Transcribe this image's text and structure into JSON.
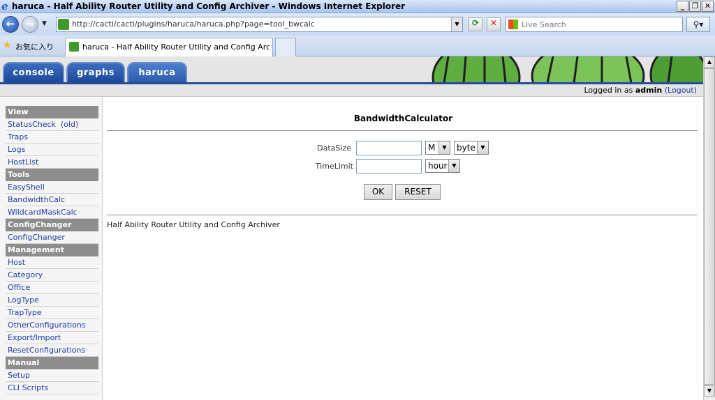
{
  "window": {
    "title": "haruca - Half Ability Router Utility and Config Archiver - Windows Internet Explorer",
    "minimize_glyph": "_",
    "maximize_glyph": "❐",
    "close_glyph": "✕"
  },
  "browser": {
    "address": "http://cacti/cacti/plugins/haruca/haruca.php?page=tool_bwcalc",
    "search_placeholder": "Live Search",
    "favorites_label": "お気に入り",
    "tab_title": "haruca - Half Ability Router Utility and Config Arc..."
  },
  "cacti": {
    "tabs": [
      {
        "label": "console"
      },
      {
        "label": "graphs"
      },
      {
        "label": "haruca"
      }
    ],
    "login_prefix": "Logged in as",
    "username": "admin",
    "logout_label": "(Logout)"
  },
  "sidebar": {
    "sections": [
      {
        "title": "View",
        "items": [
          "StatusCheck  (old)",
          "Traps",
          "Logs",
          "HostList"
        ]
      },
      {
        "title": "Tools",
        "items": [
          "EasyShell",
          "BandwidthCalc",
          "WildcardMaskCalc"
        ]
      },
      {
        "title": "ConfigChanger",
        "items": [
          "ConfigChanger"
        ]
      },
      {
        "title": "Management",
        "items": [
          "Host",
          "Category",
          "Office",
          "LogType",
          "TrapType",
          "OtherConfigurations",
          "Export/Import",
          "ResetConfigurations"
        ]
      },
      {
        "title": "Manual",
        "items": [
          "Setup",
          "CLI Scripts"
        ]
      }
    ]
  },
  "calculator": {
    "title": "BandwidthCalculator",
    "datasize_label": "DataSize",
    "datasize_value": "",
    "datasize_unit": "M",
    "datasize_type": "byte",
    "timelimit_label": "TimeLimit",
    "timelimit_value": "",
    "timelimit_unit": "hour",
    "ok_label": "OK",
    "reset_label": "RESET"
  },
  "footer": {
    "text": "Half Ability Router Utility and Config Archiver"
  },
  "colors": {
    "tab_blue": "#1b4596",
    "menu_header_gray": "#8d8d8d",
    "link_blue": "#1a3ca7"
  }
}
